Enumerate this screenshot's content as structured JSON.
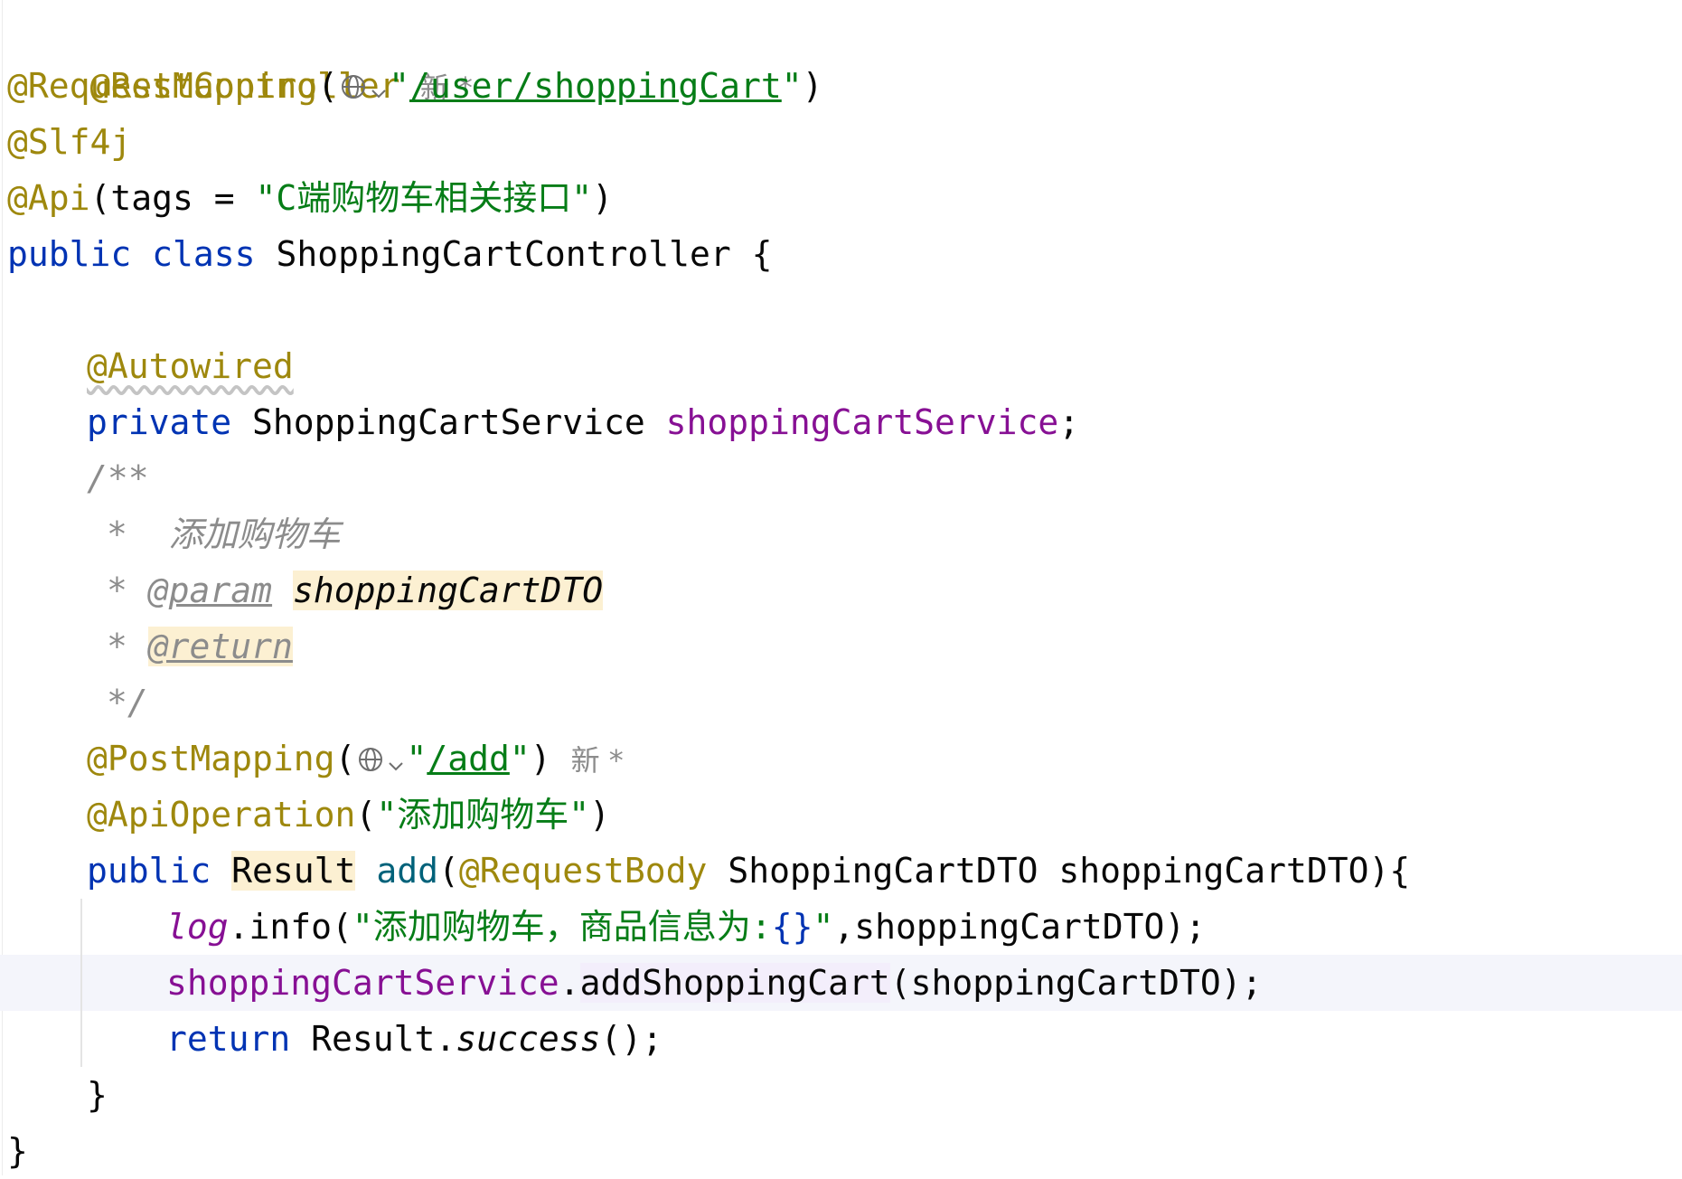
{
  "code": {
    "rest_controller": "@RestController",
    "new_hint": "新 *",
    "request_mapping": "@RequestMapping",
    "request_mapping_path": "/user/shoppingCart",
    "slf4j": "@Slf4j",
    "api_ann": "@Api",
    "api_tags_text": "(tags = ",
    "api_tags_value": "\"C端购物车相关接口\"",
    "class_kw_public": "public",
    "class_kw_class": "class",
    "class_name": "ShoppingCartController {",
    "autowired": "@Autowired",
    "private_kw": "private",
    "service_type": "ShoppingCartService",
    "service_field": "shoppingCartService",
    "semicolon": ";",
    "doc_open": "/**",
    "doc_desc": "*  添加购物车",
    "doc_star": "*",
    "doc_param_tag": "@param",
    "doc_param_name": "shoppingCartDTO",
    "doc_return_tag": "@return",
    "doc_close": "*/",
    "post_mapping": "@PostMapping",
    "post_mapping_path": "/add",
    "new_hint2": "新 *",
    "api_operation": "@ApiOperation",
    "api_operation_value": "\"添加购物车\"",
    "method_public": "public",
    "method_return_type": "Result",
    "method_name": "add",
    "request_body": "@RequestBody",
    "param_sig": "ShoppingCartDTO shoppingCartDTO){",
    "log_var": "log",
    "log_call": ".info(",
    "log_msg": "\"添加购物车，商品信息为:",
    "log_braces": "{}",
    "log_msg_end": "\"",
    "log_args": ",shoppingCartDTO);",
    "svc_var": "shoppingCartService",
    "svc_dot": ".",
    "svc_method": "addShoppingCart",
    "svc_args": "(shoppingCartDTO);",
    "return_kw": "return",
    "return_type": "Result.",
    "return_call": "success",
    "return_end": "();",
    "method_close": "}",
    "class_close": "}"
  },
  "colors": {
    "annotation": "#9e880d",
    "keyword": "#0033b3",
    "string": "#067d17",
    "field": "#871094",
    "comment": "#8c8c8c",
    "highlight": "#fcf0d2"
  },
  "icons": [
    "globe-icon",
    "chevron-down-icon"
  ]
}
